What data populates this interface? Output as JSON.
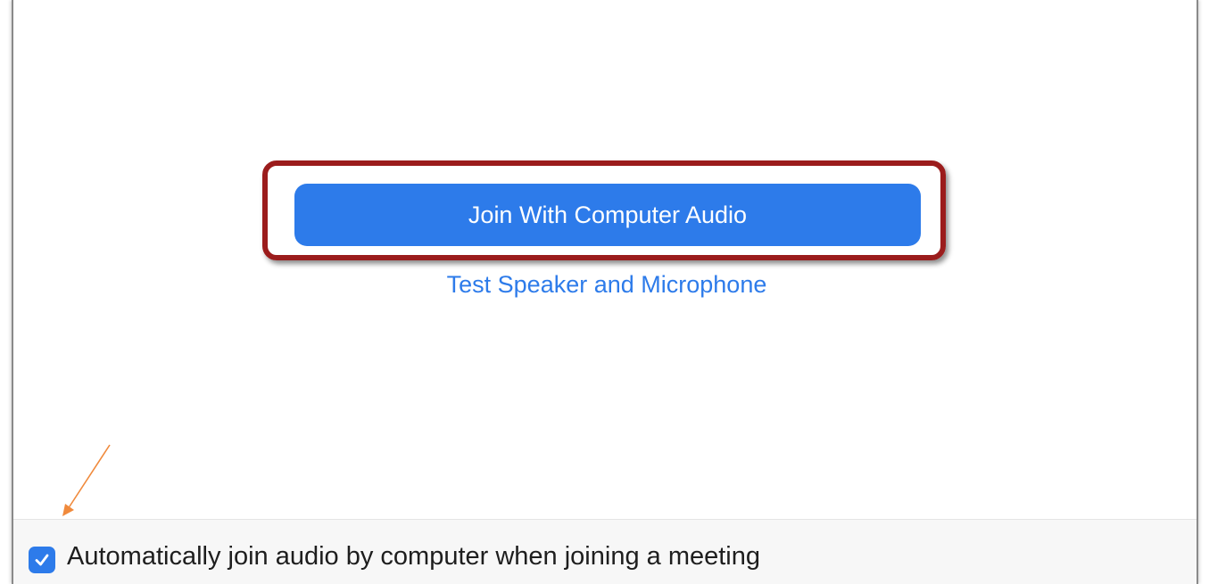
{
  "audio_dialog": {
    "join_button_label": "Join With Computer Audio",
    "test_link_label": "Test Speaker and Microphone",
    "auto_join": {
      "label": "Automatically join audio by computer when joining a meeting",
      "checked": true
    }
  },
  "annotations": {
    "highlight_color": "#9b1c1c",
    "arrow_color": "#f08a3c",
    "arrow_icon": "arrow-annotation-icon"
  },
  "colors": {
    "accent": "#2d7bea"
  }
}
